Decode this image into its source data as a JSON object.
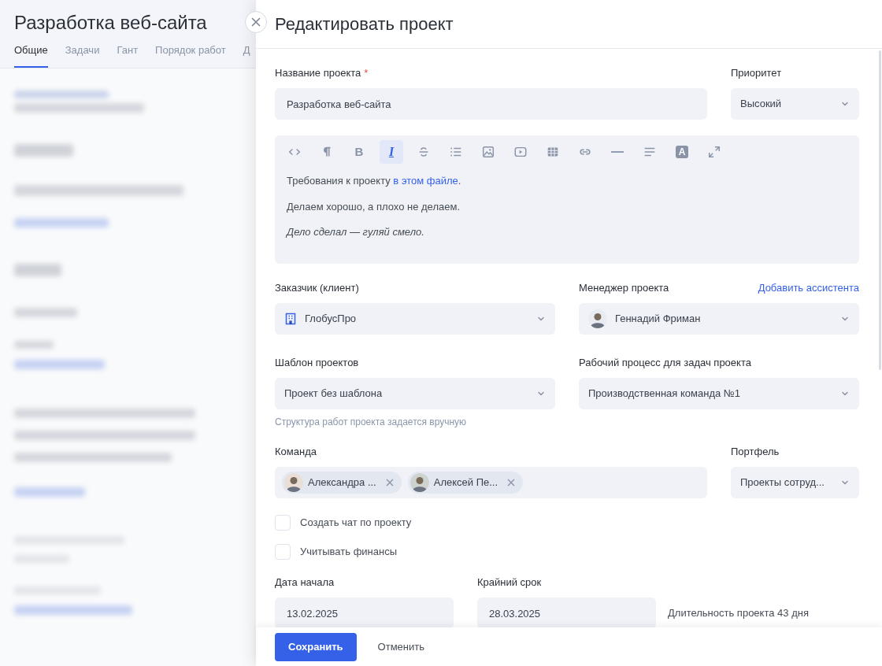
{
  "background_page": {
    "title": "Разработка веб-сайта",
    "tabs": [
      {
        "label": "Общие",
        "selected": true
      },
      {
        "label": "Задачи",
        "selected": false
      },
      {
        "label": "Гант",
        "selected": false
      },
      {
        "label": "Порядок работ",
        "selected": false
      },
      {
        "label": "Д",
        "selected": false
      }
    ]
  },
  "dialog": {
    "title": "Редактировать проект",
    "name_field": {
      "label": "Название проекта",
      "required_mark": "*",
      "value": "Разработка веб-сайта"
    },
    "priority": {
      "label": "Приоритет",
      "value": "Высокий"
    },
    "editor": {
      "toolbar": [
        {
          "kind": "code",
          "selected": false
        },
        {
          "kind": "paragraph",
          "selected": false
        },
        {
          "kind": "bold",
          "glyph": "B",
          "selected": false
        },
        {
          "kind": "italic",
          "glyph": "I",
          "selected": true
        },
        {
          "kind": "strike",
          "selected": false
        },
        {
          "kind": "list",
          "selected": false
        },
        {
          "kind": "image",
          "selected": false
        },
        {
          "kind": "video",
          "selected": false
        },
        {
          "kind": "table",
          "selected": false
        },
        {
          "kind": "link",
          "selected": false
        },
        {
          "kind": "rule",
          "selected": false
        },
        {
          "kind": "align",
          "selected": false
        },
        {
          "kind": "text-color",
          "glyph": "A",
          "selected": false
        },
        {
          "kind": "expand",
          "selected": false
        }
      ],
      "paragraphs": [
        {
          "text": "Требования к проекту",
          "link": "в этом файле",
          "after": "."
        },
        {
          "text": "Делаем хорошо, а плохо не делаем."
        },
        {
          "text": "Дело сделал — гуляй смело.",
          "italic": true
        }
      ]
    },
    "client": {
      "label": "Заказчик (клиент)",
      "value": "ГлобусПро"
    },
    "manager": {
      "label": "Менеджер проекта",
      "action": "Добавить ассистента",
      "value": "Геннадий Фриман"
    },
    "template": {
      "label": "Шаблон проектов",
      "value": "Проект без шаблона",
      "hint": "Структура работ проекта задается вручную"
    },
    "workflow": {
      "label": "Рабочий процесс для задач проекта",
      "value": "Производственная команда №1"
    },
    "team": {
      "label": "Команда",
      "members": [
        "Александра ...",
        "Алексей Пе..."
      ]
    },
    "portfolio": {
      "label": "Портфель",
      "value": "Проекты сотруд..."
    },
    "options": [
      {
        "label": "Создать чат по проекту",
        "checked": false
      },
      {
        "label": "Учитывать финансы",
        "checked": false
      }
    ],
    "start_date": {
      "label": "Дата начала",
      "value": "13.02.2025"
    },
    "deadline": {
      "label": "Крайний срок",
      "value": "28.03.2025"
    },
    "duration": "Длительность проекта 43 дня",
    "buttons": {
      "save": "Сохранить",
      "cancel": "Отменить"
    }
  }
}
